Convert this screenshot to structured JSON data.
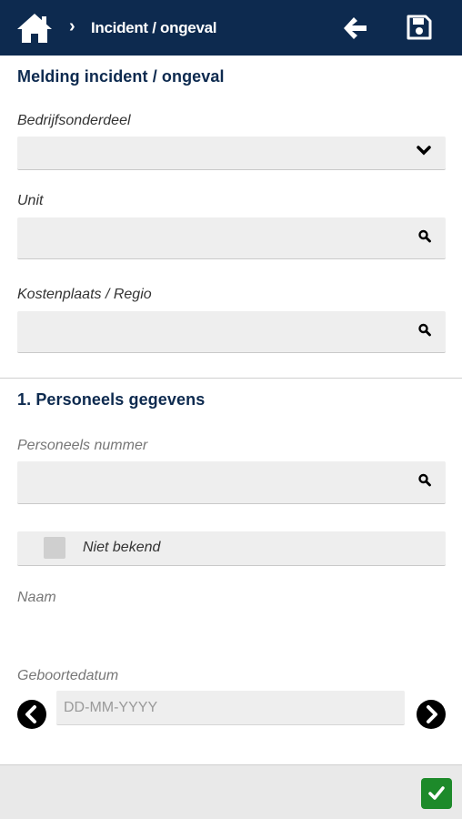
{
  "header": {
    "title": "Incident / ongeval",
    "separator": "›",
    "icons": {
      "home": "home-icon",
      "back": "arrow-left-icon",
      "save": "floppy-disk-icon"
    }
  },
  "form": {
    "section1_title": "Melding incident / ongeval",
    "bedrijfsonderdeel": {
      "label": "Bedrijfsonderdeel",
      "value": "",
      "icon": "chevron-down-icon"
    },
    "unit": {
      "label": "Unit",
      "value": "",
      "icon": "search-icon"
    },
    "kostenplaats": {
      "label": "Kostenplaats / Regio",
      "value": "",
      "icon": "search-icon"
    },
    "section2_title": "1. Personeels gegevens",
    "personeelsnummer": {
      "label": "Personeels nummer",
      "value": "",
      "icon": "search-icon"
    },
    "niet_bekend": {
      "label": "Niet bekend",
      "checked": false
    },
    "naam": {
      "label": "Naam",
      "value": ""
    },
    "geboortedatum": {
      "label": "Geboortedatum",
      "value": "",
      "placeholder": "DD-MM-YYYY"
    }
  },
  "footer": {
    "confirm_icon": "checkmark-icon"
  },
  "colors": {
    "header_bg": "#0d2a4f",
    "field_bg": "#eeeeee",
    "confirm_bg": "#1d8a2a"
  }
}
